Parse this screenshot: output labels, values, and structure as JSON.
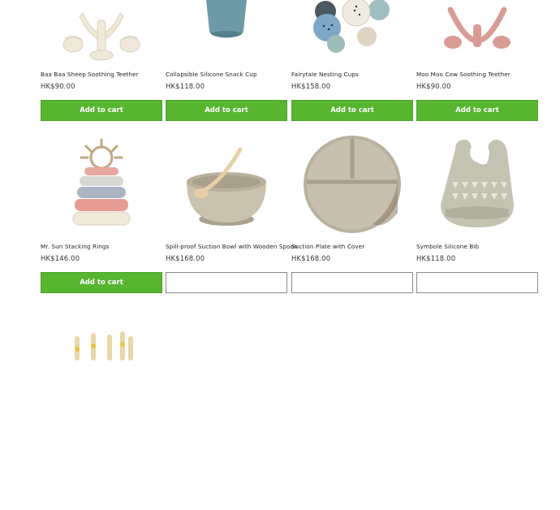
{
  "products": [
    {
      "title": "Baa Baa Sheep Soothing Teether",
      "price": "HK$90.00",
      "button": "Add to cart",
      "image_icon": "sheep-teether-icon"
    },
    {
      "title": "Collapsible Silicone Snack Cup",
      "price": "HK$118.00",
      "button": "Add to cart",
      "image_icon": "snack-cup-icon"
    },
    {
      "title": "Fairytale Nesting Cups",
      "price": "HK$158.00",
      "button": "Add to cart",
      "image_icon": "nesting-cups-icon"
    },
    {
      "title": "Moo Moo Cow Soothing Teether",
      "price": "HK$90.00",
      "button": "Add to cart",
      "image_icon": "cow-teether-icon"
    },
    {
      "title": "Mr. Sun Stacking Rings",
      "price": "HK$146.00",
      "button": "Add to cart",
      "image_icon": "stacking-rings-icon"
    },
    {
      "title": "Spill-proof Suction Bowl with Wooden Spoon",
      "price": "HK$168.00",
      "button": "",
      "image_icon": "suction-bowl-icon"
    },
    {
      "title": "Suction Plate with Cover",
      "price": "HK$168.00",
      "button": "",
      "image_icon": "suction-plate-icon"
    },
    {
      "title": "Symbole Silicone Bib",
      "price": "HK$118.00",
      "button": "",
      "image_icon": "silicone-bib-icon"
    },
    {
      "title": "",
      "price": "",
      "button": "",
      "image_icon": "wooden-toy-icon"
    }
  ],
  "colors": {
    "cart_button": "#57b530",
    "cart_button_text": "#ffffff"
  }
}
